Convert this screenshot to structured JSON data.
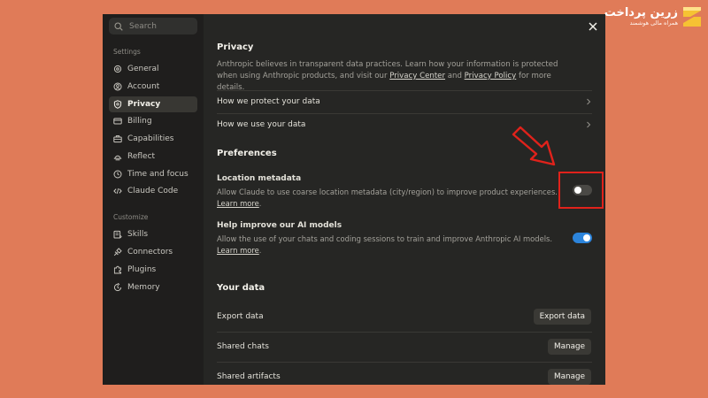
{
  "brand": {
    "name": "زرین پرداخت",
    "tagline": "همراه مالی هوشمند"
  },
  "sidebar": {
    "search_placeholder": "Search",
    "settings_label": "Settings",
    "customize_label": "Customize",
    "items": [
      {
        "label": "General",
        "icon": "gear-icon"
      },
      {
        "label": "Account",
        "icon": "user-circle-icon"
      },
      {
        "label": "Privacy",
        "icon": "shield-icon",
        "active": true
      },
      {
        "label": "Billing",
        "icon": "card-icon"
      },
      {
        "label": "Capabilities",
        "icon": "briefcase-icon"
      },
      {
        "label": "Reflect",
        "icon": "sunrise-icon"
      },
      {
        "label": "Time and focus",
        "icon": "clock-icon"
      },
      {
        "label": "Claude Code",
        "icon": "code-icon"
      }
    ],
    "customize_items": [
      {
        "label": "Skills",
        "icon": "skills-icon"
      },
      {
        "label": "Connectors",
        "icon": "plug-icon"
      },
      {
        "label": "Plugins",
        "icon": "puzzle-icon"
      },
      {
        "label": "Memory",
        "icon": "memory-icon"
      }
    ]
  },
  "main": {
    "privacy_title": "Privacy",
    "privacy_desc_1": "Anthropic believes in transparent data practices. Learn how your information is protected when using Anthropic products, and visit our ",
    "privacy_center_link": "Privacy Center",
    "privacy_desc_and": " and ",
    "privacy_policy_link": "Privacy Policy",
    "privacy_desc_end": " for more details.",
    "links": [
      {
        "label": "How we protect your data"
      },
      {
        "label": "How we use your data"
      }
    ],
    "preferences_title": "Preferences",
    "location": {
      "title": "Location metadata",
      "desc": "Allow Claude to use coarse location metadata (city/region) to improve product experiences. ",
      "link": "Learn more",
      "period": ".",
      "enabled": false
    },
    "improve": {
      "title": "Help improve our AI models",
      "desc": "Allow the use of your chats and coding sessions to train and improve Anthropic AI models. ",
      "link": "Learn more",
      "period": ".",
      "enabled": true
    },
    "your_data_title": "Your data",
    "export": {
      "label": "Export data",
      "button": "Export data"
    },
    "shared_chats": {
      "label": "Shared chats",
      "button": "Manage"
    },
    "shared_artifacts": {
      "label": "Shared artifacts",
      "button": "Manage"
    }
  },
  "colors": {
    "background": "#e07b58",
    "toggle_on": "#2c84db",
    "annotation": "#e0221b"
  }
}
